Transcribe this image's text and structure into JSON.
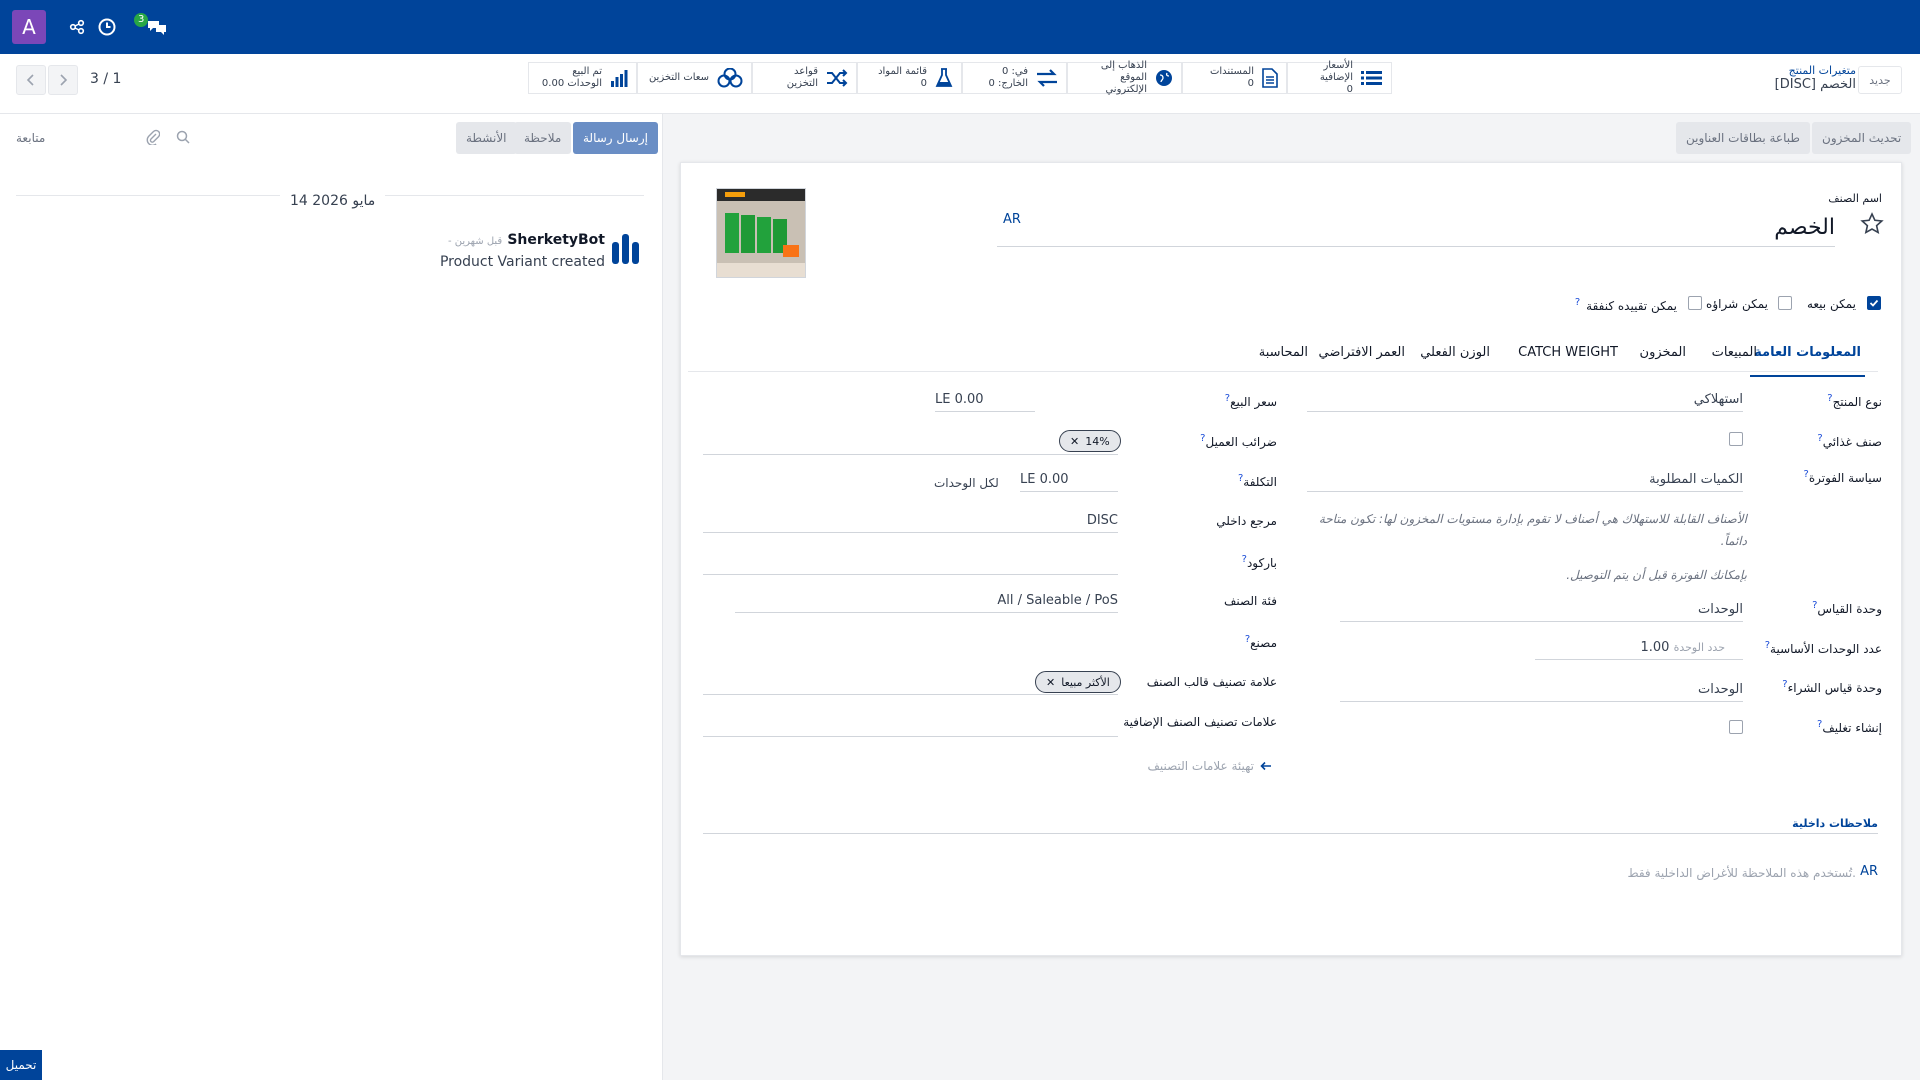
{
  "topbar": {
    "avatar_letter": "A",
    "badge_count": "3"
  },
  "pager": {
    "value": "3 / 1"
  },
  "breadcrumb": {
    "parent": "متغيرات المنتج",
    "current": "[DISC] الخصم",
    "new_button": "جديد"
  },
  "smart_buttons": [
    {
      "label": "الأسعار الإضافية",
      "value": "0",
      "icon": "list-icon"
    },
    {
      "label": "المستندات",
      "value": "0",
      "icon": "document-icon"
    },
    {
      "label": "الذهاب إلى",
      "label2": "الموقع الإلكتروني",
      "icon": "globe-icon"
    },
    {
      "label": "في: 0",
      "label2": "الخارج: 0",
      "icon": "transfer-icon"
    },
    {
      "label": "قائمة المواد",
      "value": "0",
      "icon": "flask-icon"
    },
    {
      "label": "قواعد التخزين",
      "icon": "shuffle-icon"
    },
    {
      "label": "سعات التخزين",
      "icon": "boxes-icon"
    },
    {
      "label": "تم البيع",
      "label2": "0.00 الوحدات",
      "icon": "chart-icon"
    }
  ],
  "header_buttons": {
    "update_stock": "تحديث المخزون",
    "print_labels": "طباعة بطاقات العناوين"
  },
  "chatter": {
    "send_message": "إرسال رسالة",
    "note": "ملاحظة",
    "activities": "الأنشطة",
    "follow": "متابعة",
    "date": "14 مايو 2026",
    "author": "SherketyBot",
    "time": "- قبل شهرين",
    "body": "Product Variant created",
    "upload": "تحميل"
  },
  "form": {
    "name_label": "اسم الصنف",
    "name_value": "الخصم",
    "lang": "AR",
    "options": {
      "can_sell": "يمكن بيعه",
      "can_buy": "يمكن شراؤه",
      "can_expense": "يمكن تقييده كنفقة"
    },
    "tabs": [
      "المعلومات العامة",
      "المبيعات",
      "المخزون",
      "CATCH WEIGHT",
      "الوزن الفعلي",
      "العمر الافتراضي",
      "المحاسبة"
    ],
    "right": {
      "product_type_label": "نوع المنتج",
      "product_type_value": "استهلاكي",
      "food_label": "صنف غذائي",
      "invoice_policy_label": "سياسة الفوترة",
      "invoice_policy_value": "الكميات المطلوبة",
      "note1": "الأصناف القابلة للاستهلاك هي أصناف لا تقوم بإدارة مستويات المخزون لها: تكون متاحة دائماً.",
      "note2": "بإمكانك الفوترة قبل أن يتم التوصيل.",
      "uom_label": "وحدة القياس",
      "uom_value": "الوحدات",
      "base_units_label": "عدد الوحدات الأساسية",
      "base_units_value": "1.00",
      "base_units_placeholder": "حدد الوحدة",
      "purchase_uom_label": "وحدة قياس الشراء",
      "purchase_uom_value": "الوحدات",
      "packaging_label": "إنشاء تغليف"
    },
    "left": {
      "sale_price_label": "سعر البيع",
      "sale_price_value": "LE 0.00",
      "customer_taxes_label": "ضرائب العميل",
      "customer_taxes_tag": "14%",
      "cost_label": "التكلفة",
      "cost_value": "LE 0.00",
      "cost_suffix": "لكل الوحدات",
      "internal_ref_label": "مرجع داخلي",
      "internal_ref_value": "DISC",
      "barcode_label": "باركود",
      "category_label": "فئة الصنف",
      "category_value": "All / Saleable / PoS",
      "manufacturer_label": "مصنع",
      "template_tags_label": "علامة تصنيف قالب الصنف",
      "template_tag": "الأكثر مبيعا",
      "extra_tags_label": "علامات تصنيف الصنف الإضافية",
      "configure_tags": "تهيئة علامات التصنيف"
    },
    "internal_notes_label": "ملاحظات داخلية",
    "internal_notes_placeholder": "تُستخدم هذه الملاحظة للأغراض الداخلية فقط.",
    "notes_lang": "AR"
  },
  "colors": {
    "brand": "#00449a",
    "avatar": "#7b47b8",
    "badge": "#28a745"
  }
}
